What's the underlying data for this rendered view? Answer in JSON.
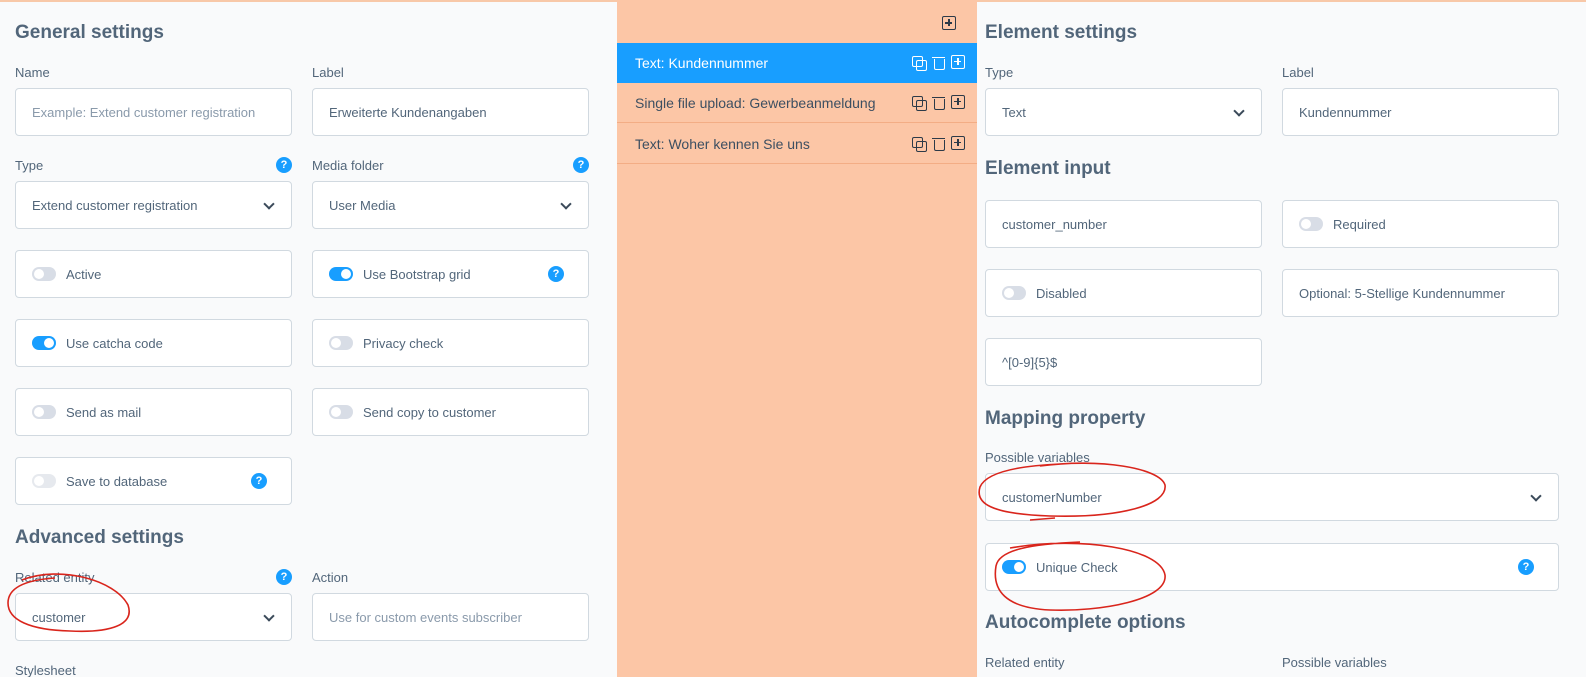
{
  "general": {
    "title": "General settings",
    "name_label": "Name",
    "name_placeholder": "Example: Extend customer registration",
    "label_label": "Label",
    "label_value": "Erweiterte Kundenangaben",
    "type_label": "Type",
    "type_value": "Extend customer registration",
    "media_label": "Media folder",
    "media_value": "User Media",
    "active_label": "Active",
    "bootstrap_label": "Use Bootstrap grid",
    "captcha_label": "Use catcha code",
    "privacy_label": "Privacy check",
    "mail_label": "Send as mail",
    "copy_label": "Send copy to customer",
    "db_label": "Save to database",
    "help_glyph": "?"
  },
  "advanced": {
    "title": "Advanced settings",
    "entity_label": "Related entity",
    "entity_value": "customer",
    "action_label": "Action",
    "action_placeholder": "Use for custom events subscriber",
    "stylesheet_label": "Stylesheet"
  },
  "elements": {
    "items": [
      {
        "label": "Text: Kundennummer",
        "active": true
      },
      {
        "label": "Single file upload: Gewerbeanmeldung",
        "active": false
      },
      {
        "label": "Text: Woher kennen Sie uns",
        "active": false
      }
    ]
  },
  "element_settings": {
    "title": "Element settings",
    "type_label": "Type",
    "type_value": "Text",
    "label_label": "Label",
    "label_value": "Kundennummer"
  },
  "element_input": {
    "title": "Element input",
    "name_value": "customer_number",
    "required_label": "Required",
    "disabled_label": "Disabled",
    "placeholder_value": "Optional: 5-Stellige Kundennummer",
    "pattern_value": "^[0-9]{5}$"
  },
  "mapping": {
    "title": "Mapping property",
    "vars_label": "Possible variables",
    "vars_value": "customerNumber",
    "unique_label": "Unique Check"
  },
  "autocomplete": {
    "title": "Autocomplete options",
    "entity_label": "Related entity",
    "vars_label": "Possible variables"
  },
  "colors": {
    "accent": "#189eff",
    "middle_panel": "#fcc6a6",
    "annotation": "#d9251c"
  }
}
